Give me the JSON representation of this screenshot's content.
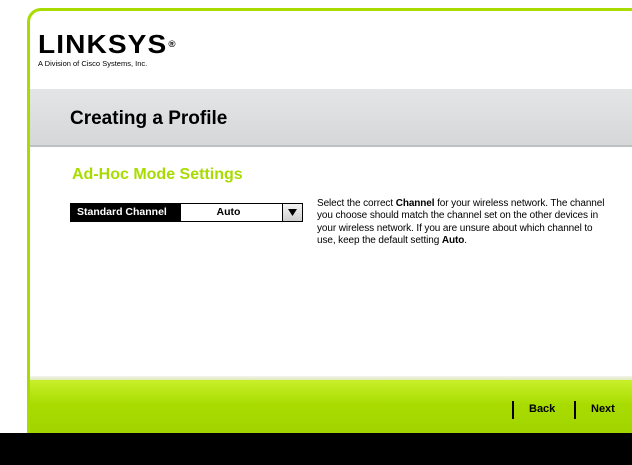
{
  "brand": {
    "logo_text": "LINKSYS",
    "logo_mark": "®",
    "logo_tagline": "A Division of Cisco Systems, Inc."
  },
  "header": {
    "title": "Creating a Profile"
  },
  "section": {
    "title": "Ad-Hoc Mode Settings"
  },
  "channel": {
    "label": "Standard Channel",
    "value": "Auto",
    "dropdown_icon": "triangle-down-icon"
  },
  "help": {
    "part1": "Select the correct ",
    "bold1": "Channel",
    "part2": " for your wireless network. The channel you choose should match the channel set on the other devices in your wireless network. If you are unsure about which channel to use, keep the default setting ",
    "bold2": "Auto",
    "part3": "."
  },
  "nav": {
    "back_label": "Back",
    "next_label": "Next"
  },
  "colors": {
    "accent_green": "#a8dc00",
    "title_band": "#d9dadb",
    "footer": "#000000"
  }
}
